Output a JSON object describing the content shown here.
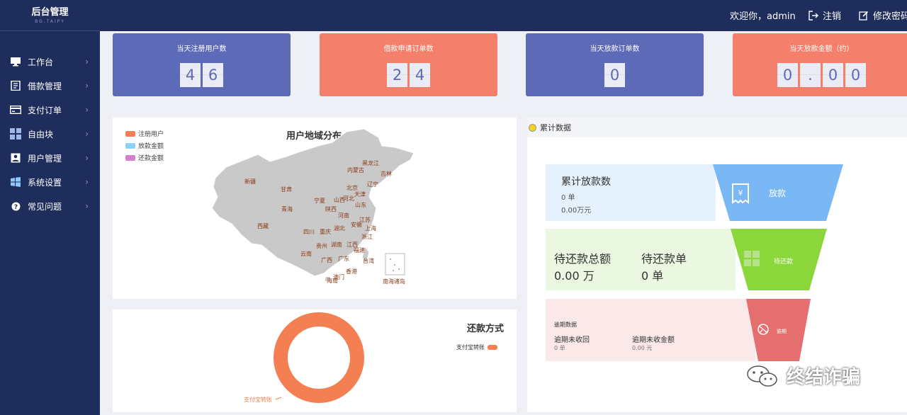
{
  "brand": {
    "title": "后台管理",
    "subtitle": "BG.TAIPY"
  },
  "topbar": {
    "welcome": "欢迎你，admin",
    "logout": "注销",
    "change_password": "修改密码"
  },
  "sidebar": {
    "items": [
      {
        "label": "工作台",
        "icon": "monitor-icon"
      },
      {
        "label": "借款管理",
        "icon": "document-icon"
      },
      {
        "label": "支付订单",
        "icon": "card-icon"
      },
      {
        "label": "自由块",
        "icon": "grid-icon"
      },
      {
        "label": "用户管理",
        "icon": "user-icon"
      },
      {
        "label": "系统设置",
        "icon": "windows-icon"
      },
      {
        "label": "常见问题",
        "icon": "question-icon"
      }
    ],
    "arrow": "›"
  },
  "stats": [
    {
      "title": "当天注册用户数",
      "digits": [
        "4",
        "6"
      ],
      "color": "#5d6ab8"
    },
    {
      "title": "借款申请订单数",
      "digits": [
        "2",
        "4"
      ],
      "color": "#f47f6b"
    },
    {
      "title": "当天放款订单数",
      "digits": [
        "0"
      ],
      "color": "#5d6ab8"
    },
    {
      "title": "当天放款金额（约）",
      "digits": [
        "0",
        ".",
        "0",
        "0"
      ],
      "color": "#f47f6b"
    }
  ],
  "map": {
    "title": "用户地域分布",
    "legend": [
      {
        "name": "注册用户",
        "color": "#f47f52"
      },
      {
        "name": "放款金额",
        "color": "#8fd1f2"
      },
      {
        "name": "还款金额",
        "color": "#d97fd0"
      }
    ],
    "provinces": [
      "黑龙江",
      "吉林",
      "内蒙古",
      "辽宁",
      "新疆",
      "甘肃",
      "北京",
      "天津",
      "宁夏",
      "山西",
      "河北",
      "陕西",
      "山东",
      "青海",
      "河南",
      "江苏",
      "安徽",
      "上海",
      "西藏",
      "四川",
      "重庆",
      "湖北",
      "浙江",
      "贵州",
      "湖南",
      "江西",
      "福建",
      "云南",
      "广西",
      "广东",
      "台湾",
      "香港",
      "澳门",
      "海南",
      "南海诸岛"
    ]
  },
  "payment": {
    "title": "还款方式",
    "legend": "支付宝转账",
    "slice_label": "支付宝转账",
    "slice_color": "#f47f52"
  },
  "cumulative": {
    "header": "累计数据",
    "loan": {
      "title": "累计放款数",
      "count": "0 单",
      "amount": "0.00万元",
      "funnel_label": "放款",
      "icon": "yen-receipt-icon"
    },
    "pending": {
      "label_total": "待还款总额",
      "value_total": "0.00 万",
      "label_orders": "待还款单",
      "value_orders": "0 单",
      "funnel_label": "待还款",
      "icon": "grid-icon"
    },
    "overdue": {
      "title": "逾期数据",
      "label_unrecovered": "逾期未收回",
      "value_unrecovered": "0 单",
      "label_amount": "逾期未收金额",
      "value_amount": "0.00 元",
      "funnel_label": "逾期",
      "icon": "broken-icon"
    }
  },
  "watermark": {
    "text": "终结诈骗",
    "icon": "wechat-icon"
  }
}
